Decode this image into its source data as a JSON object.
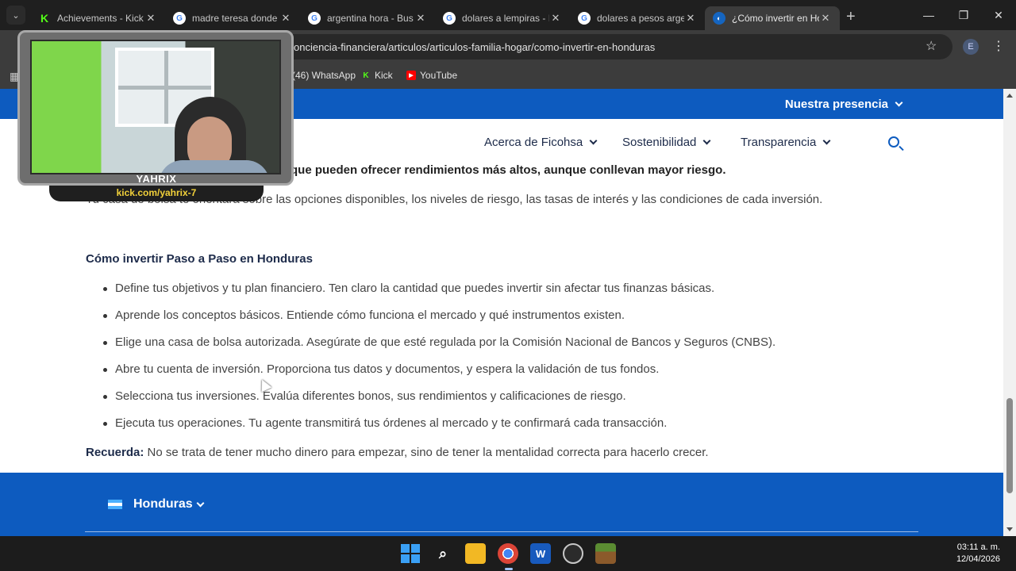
{
  "browser": {
    "tabs": [
      {
        "title": "Achievements - Kick",
        "favicon": "kick-icon",
        "active": false
      },
      {
        "title": "madre teresa donde",
        "favicon": "google-icon",
        "active": false
      },
      {
        "title": "argentina hora - Bus",
        "favicon": "google-icon",
        "active": false
      },
      {
        "title": "dolares a lempiras - I",
        "favicon": "google-icon",
        "active": false
      },
      {
        "title": "dolares a pesos arge",
        "favicon": "google-icon",
        "active": false
      },
      {
        "title": "¿Cómo invertir en Ho",
        "favicon": "ficohsa-icon",
        "active": true
      }
    ],
    "tab_close": "✕",
    "new_tab": "+",
    "tab_search": "⌄",
    "window_controls": {
      "minimize": "—",
      "maximize": "❐",
      "close": "✕"
    },
    "url": "onciencia-financiera/articulos/articulos-familia-hogar/como-invertir-en-honduras",
    "star": "☆",
    "profile_initial": "E",
    "menu": "⋮",
    "bookmarks": [
      {
        "label": "(46) WhatsApp",
        "icon": "whatsapp-icon",
        "color": "#25d366"
      },
      {
        "label": "Kick",
        "icon": "kick-icon",
        "color": "#53fc18"
      },
      {
        "label": "YouTube",
        "icon": "youtube-icon",
        "color": "#ff0000"
      }
    ]
  },
  "site": {
    "presence": "Nuestra presencia",
    "nav": [
      {
        "label": "Acerca de Ficohsa"
      },
      {
        "label": "Sostenibilidad"
      },
      {
        "label": "Transparencia"
      }
    ],
    "brand_color": "#0d5bbf"
  },
  "article": {
    "bold_line": "que pueden ofrecer rendimientos más altos, aunque conllevan mayor riesgo.",
    "paragraph": "Tu casa de bolsa te orientará sobre las opciones disponibles, los niveles de riesgo, las tasas de interés y las condiciones de cada inversión.",
    "heading": "Cómo invertir Paso a Paso en Honduras",
    "steps": [
      "Define tus objetivos y tu plan financiero. Ten claro la cantidad que puedes invertir sin afectar tus finanzas básicas.",
      "Aprende los conceptos básicos. Entiende cómo funciona el mercado y qué instrumentos existen.",
      "Elige una casa de bolsa autorizada. Asegúrate de que esté regulada por la Comisión Nacional de Bancos y Seguros (CNBS).",
      "Abre tu cuenta de inversión. Proporciona tus datos y documentos, y espera la validación de tus fondos.",
      "Selecciona tus inversiones. Evalúa diferentes bonos, sus rendimientos y calificaciones de riesgo.",
      "Ejecuta tus operaciones. Tu agente transmitirá tus órdenes al mercado y te confirmará cada transacción."
    ],
    "reminder_label": "Recuerda:",
    "reminder_text": " No se trata de tener mucho dinero para empezar, sino de tener la mentalidad correcta para hacerlo crecer."
  },
  "footer": {
    "country": "Honduras"
  },
  "stream_overlay": {
    "name": "YAHRIX",
    "url": "kick.com/yahrix-7"
  },
  "taskbar": {
    "apps": [
      "windows-start-icon",
      "search-icon",
      "file-explorer-icon",
      "chrome-icon",
      "word-icon",
      "obs-icon",
      "minecraft-icon"
    ],
    "time": "03:11 a. m.",
    "date": "12/04/2026"
  }
}
